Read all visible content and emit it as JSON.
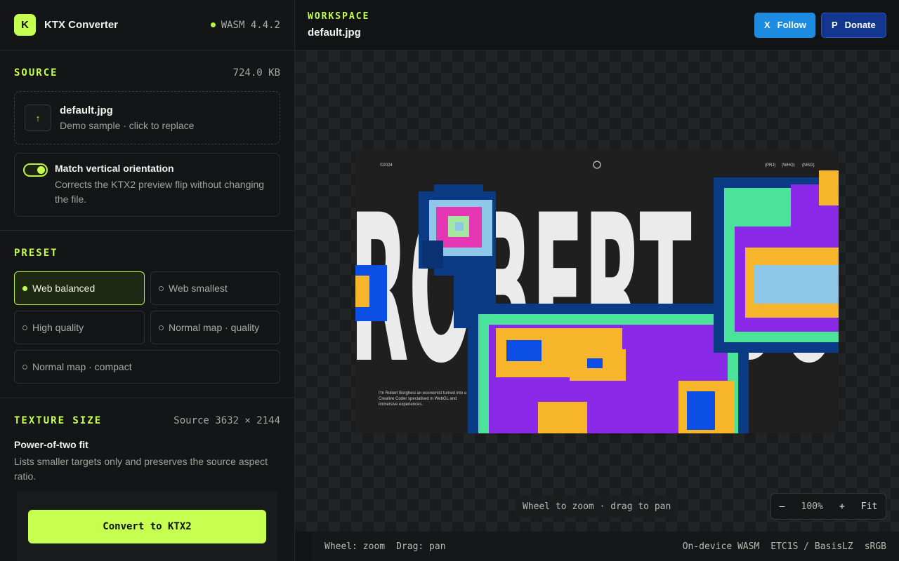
{
  "app": {
    "logo_letter": "K",
    "title": "KTX Converter",
    "runtime": "WASM 4.4.2"
  },
  "source": {
    "title": "SOURCE",
    "size": "724.0 KB",
    "file_name": "default.jpg",
    "file_sub": "Demo sample · click to replace",
    "upload_icon": "↑"
  },
  "orientation": {
    "title": "Match vertical orientation",
    "desc": "Corrects the KTX2 preview flip without changing the file.",
    "enabled": true
  },
  "preset": {
    "title": "PRESET",
    "items": [
      {
        "label": "Web balanced",
        "active": true
      },
      {
        "label": "Web smallest",
        "active": false
      },
      {
        "label": "High quality",
        "active": false
      },
      {
        "label": "Normal map · quality",
        "active": false
      },
      {
        "label": "Normal map · compact",
        "active": false
      }
    ]
  },
  "texture": {
    "title": "TEXTURE SIZE",
    "source_dims": "Source 3632 × 2144",
    "fit_title": "Power-of-two fit",
    "fit_desc": "Lists smaller targets only and preserves the source aspect ratio."
  },
  "convert_label": "Convert to KTX2",
  "workspace": {
    "label": "WORKSPACE",
    "file": "default.jpg",
    "follow": {
      "icon": "X",
      "label": "Follow"
    },
    "donate": {
      "icon": "P",
      "label": "Donate"
    }
  },
  "preview": {
    "year": "©2024",
    "nav": [
      "(PRJ)",
      "(WHO)",
      "(MSG)"
    ],
    "headline": "ROBERT BO",
    "caption": "I'm Robert Borghesi an economist turned into a Creative Coder specialised in WebGL and immersive experiences."
  },
  "canvas_hint": "Wheel to zoom · drag to pan",
  "zoom": {
    "minus": "–",
    "level": "100%",
    "plus": "+",
    "fit": "Fit"
  },
  "status": {
    "left": [
      "Wheel: zoom",
      "Drag: pan"
    ],
    "right": [
      "On-device WASM",
      "ETC1S / BasisLZ",
      "sRGB"
    ]
  },
  "colors": {
    "accent": "#c6ff4f",
    "follow": "#1d8ce0",
    "donate": "#13368f"
  }
}
